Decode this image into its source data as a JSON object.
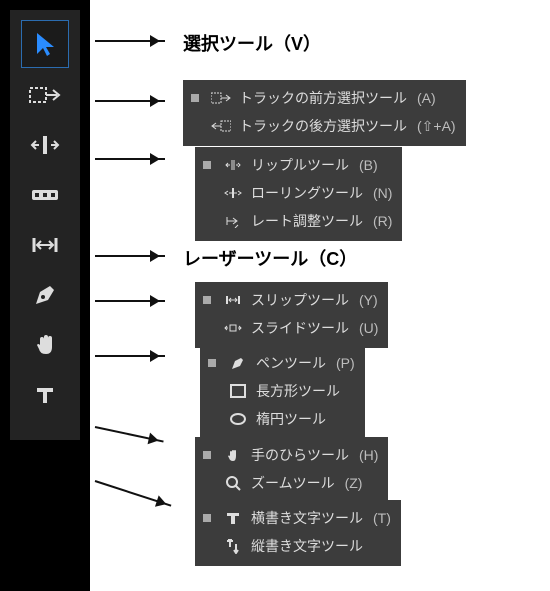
{
  "labels": {
    "selection": "選択ツール（V）",
    "razor": "レーザーツール（C）"
  },
  "panels": {
    "track": {
      "forward": "トラックの前方選択ツール",
      "forward_sc": "(A)",
      "backward": "トラックの後方選択ツール",
      "backward_sc": "(⇧+A)"
    },
    "ripple": {
      "ripple": "リップルツール",
      "ripple_sc": "(B)",
      "rolling": "ローリングツール",
      "rolling_sc": "(N)",
      "rate": "レート調整ツール",
      "rate_sc": "(R)"
    },
    "slip": {
      "slip": "スリップツール",
      "slip_sc": "(Y)",
      "slide": "スライドツール",
      "slide_sc": "(U)"
    },
    "pen": {
      "pen": "ペンツール",
      "pen_sc": "(P)",
      "rect": "長方形ツール",
      "ellipse": "楕円ツール"
    },
    "hand": {
      "hand": "手のひらツール",
      "hand_sc": "(H)",
      "zoom": "ズームツール",
      "zoom_sc": "(Z)"
    },
    "text": {
      "h": "横書き文字ツール",
      "h_sc": "(T)",
      "v": "縦書き文字ツール"
    }
  }
}
